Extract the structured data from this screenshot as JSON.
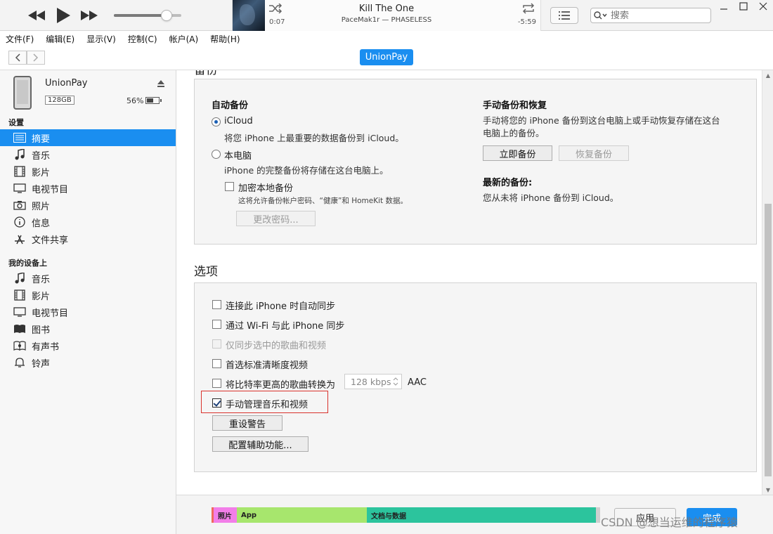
{
  "player": {
    "track_title": "Kill The One",
    "track_artist": "PaceMak1r — PHASELESS",
    "elapsed": "0:07",
    "remaining": "-5:59",
    "volume": 0.78
  },
  "search": {
    "placeholder": "搜索"
  },
  "menu": [
    "文件(F)",
    "编辑(E)",
    "显示(V)",
    "控制(C)",
    "帐户(A)",
    "帮助(H)"
  ],
  "device": {
    "pill_label": "UnionPay",
    "name": "UnionPay",
    "capacity": "128GB",
    "battery": "56%",
    "battery_level": 0.56
  },
  "sidebar": {
    "settings_header": "设置",
    "settings_items": [
      {
        "label": "摘要",
        "icon": "summary-icon"
      },
      {
        "label": "音乐",
        "icon": "music-note-icon"
      },
      {
        "label": "影片",
        "icon": "film-icon"
      },
      {
        "label": "电视节目",
        "icon": "tv-icon"
      },
      {
        "label": "照片",
        "icon": "camera-icon"
      },
      {
        "label": "信息",
        "icon": "info-icon"
      },
      {
        "label": "文件共享",
        "icon": "app-store-icon"
      }
    ],
    "mydevice_header": "我的设备上",
    "mydevice_items": [
      {
        "label": "音乐",
        "icon": "music-note-icon"
      },
      {
        "label": "影片",
        "icon": "film-icon"
      },
      {
        "label": "电视节目",
        "icon": "tv-icon"
      },
      {
        "label": "图书",
        "icon": "book-icon"
      },
      {
        "label": "有声书",
        "icon": "audiobook-icon"
      },
      {
        "label": "铃声",
        "icon": "bell-icon"
      }
    ]
  },
  "backup": {
    "heading": "备份",
    "auto_title": "自动备份",
    "icloud_label": "iCloud",
    "icloud_desc": "将您 iPhone 上最重要的数据备份到 iCloud。",
    "computer_label": "本电脑",
    "computer_desc": "iPhone 的完整备份将存储在这台电脑上。",
    "encrypt_label": "加密本地备份",
    "encrypt_desc": "这将允许备份帐户密码、“健康”和 HomeKit 数据。",
    "change_pw_btn": "更改密码...",
    "manual_title": "手动备份和恢复",
    "manual_desc_1": "手动将您的 iPhone 备份到这台电脑上或手动恢复存储在这台",
    "manual_desc_2": "电脑上的备份。",
    "backup_now_btn": "立即备份",
    "restore_btn": "恢复备份",
    "latest_title": "最新的备份:",
    "latest_desc": "您从未将 iPhone 备份到 iCloud。"
  },
  "options": {
    "heading": "选项",
    "opt1": "连接此 iPhone 时自动同步",
    "opt2": "通过 Wi-Fi 与此 iPhone 同步",
    "opt3": "仅同步选中的歌曲和视频",
    "opt4": "首选标准清晰度视频",
    "opt5": "将比特率更高的歌曲转换为",
    "bitrate": "128 kbps",
    "aac": "AAC",
    "opt6": "手动管理音乐和视频",
    "reset_btn": "重设警告",
    "access_btn": "配置辅助功能..."
  },
  "storage": {
    "segments": [
      {
        "label": "",
        "color": "#f06a5c",
        "fraction": 0.005
      },
      {
        "label": "照片",
        "color": "#f27ee8",
        "fraction": 0.06
      },
      {
        "label": "App",
        "color": "#a7e66d",
        "fraction": 0.335
      },
      {
        "label": "文档与数据",
        "color": "#2cc49d",
        "fraction": 0.59
      },
      {
        "label": "",
        "color": "#cfcfcf",
        "fraction": 0.01
      }
    ]
  },
  "footer": {
    "apply": "应用",
    "done": "完成",
    "watermark": "CSDN @想当运维的程序猿"
  }
}
